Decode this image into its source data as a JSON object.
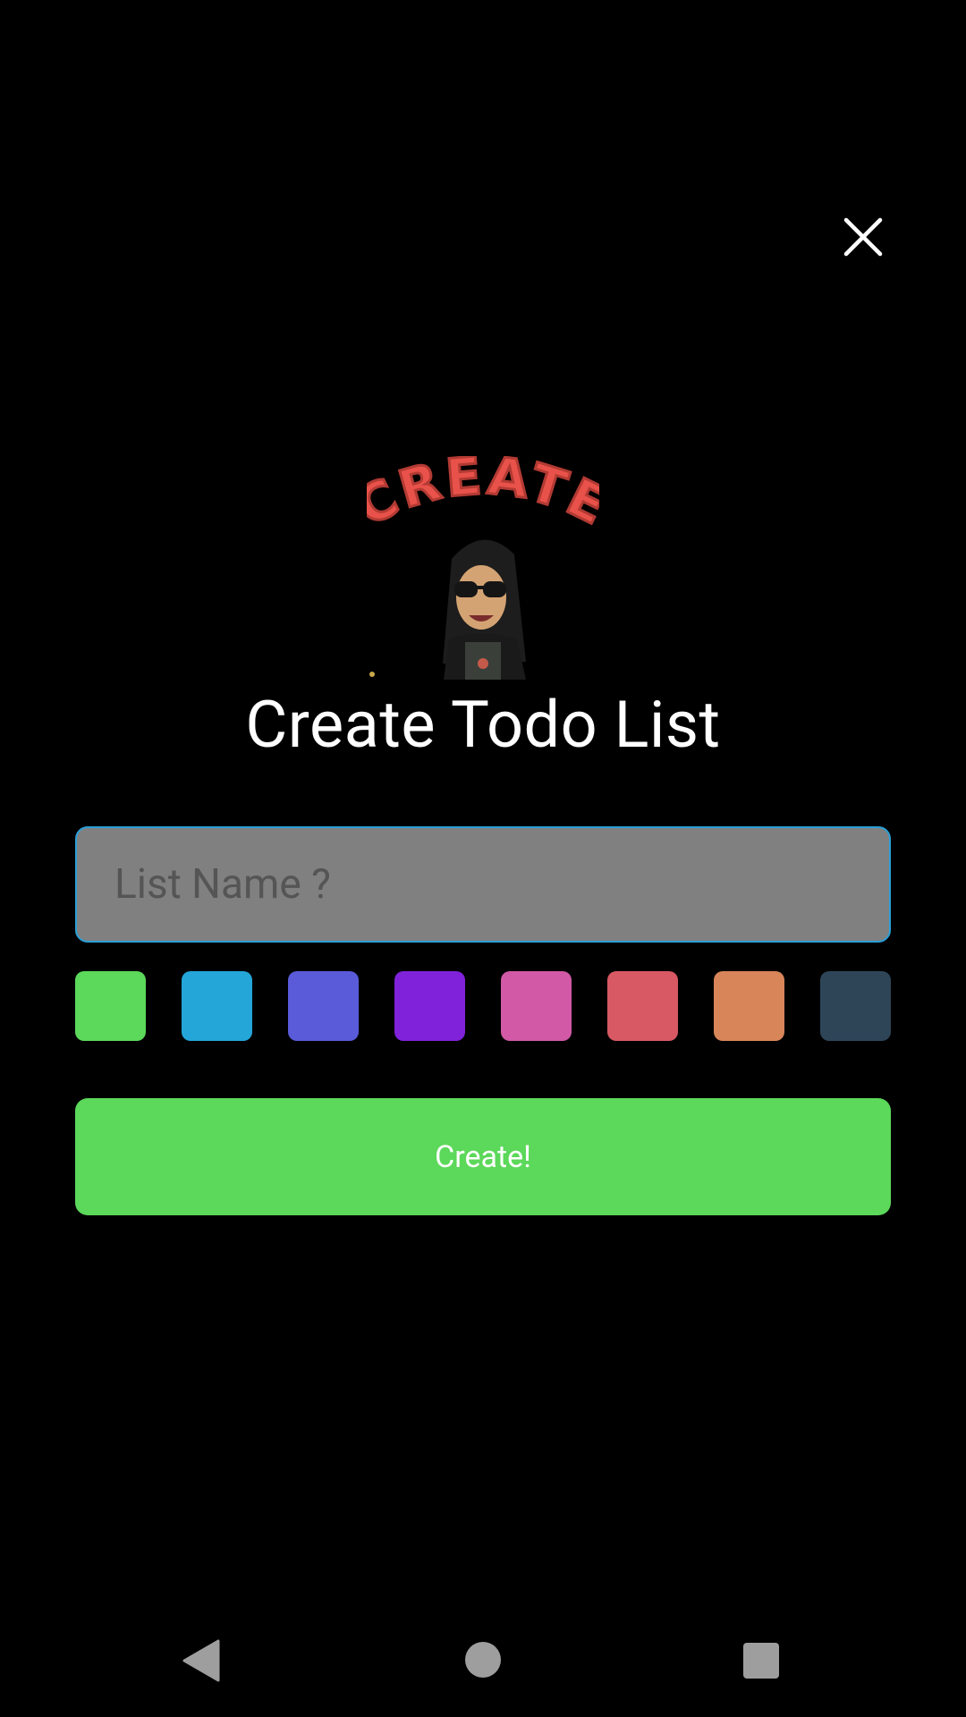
{
  "sticker": {
    "text": "CREATE"
  },
  "title": "Create Todo List",
  "input": {
    "placeholder": "List Name ?",
    "value": ""
  },
  "colors": [
    {
      "name": "green",
      "hex": "#5cd85a"
    },
    {
      "name": "blue",
      "hex": "#24a6d9"
    },
    {
      "name": "indigo",
      "hex": "#595bd9"
    },
    {
      "name": "purple",
      "hex": "#8022d9"
    },
    {
      "name": "magenta",
      "hex": "#d159a6"
    },
    {
      "name": "red",
      "hex": "#d85963"
    },
    {
      "name": "orange",
      "hex": "#d88559"
    },
    {
      "name": "navy",
      "hex": "#2e4558"
    }
  ],
  "selected_color": "#5cd85a",
  "create_button": {
    "label": "Create!"
  },
  "system_nav": {
    "back": "back-icon",
    "home": "home-icon",
    "recents": "recents-icon"
  }
}
